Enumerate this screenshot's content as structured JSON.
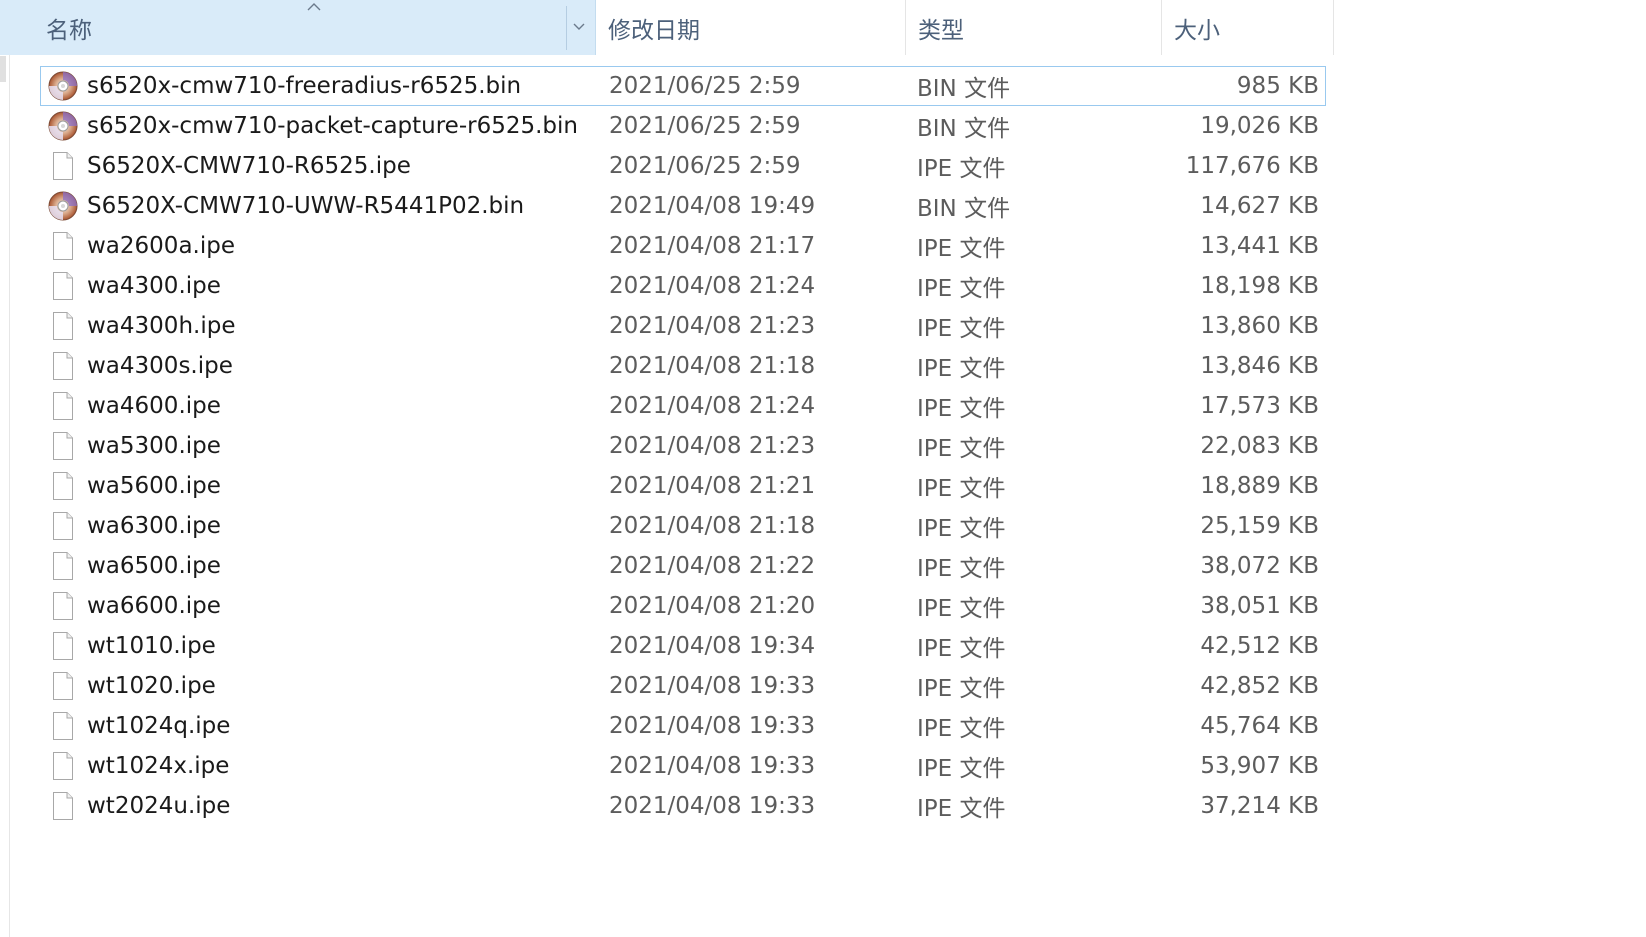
{
  "header": {
    "columns": {
      "name": "名称",
      "date": "修改日期",
      "type": "类型",
      "size": "大小"
    },
    "sort_icon": "sort-up-icon",
    "dropdown_icon": "chevron-down-icon"
  },
  "colors": {
    "header_highlight": "#d9ebf9",
    "selected_border": "#99c9ef",
    "header_text": "#4c607a"
  },
  "files": [
    {
      "name": "s6520x-cmw710-freeradius-r6525.bin",
      "date": "2021/06/25 2:59",
      "type": "BIN 文件",
      "size": "985 KB",
      "icon": "disc-image-icon",
      "selected": true
    },
    {
      "name": "s6520x-cmw710-packet-capture-r6525.bin",
      "date": "2021/06/25 2:59",
      "type": "BIN 文件",
      "size": "19,026 KB",
      "icon": "disc-image-icon",
      "selected": false
    },
    {
      "name": "S6520X-CMW710-R6525.ipe",
      "date": "2021/06/25 2:59",
      "type": "IPE 文件",
      "size": "117,676 KB",
      "icon": "blank-file-icon",
      "selected": false
    },
    {
      "name": "S6520X-CMW710-UWW-R5441P02.bin",
      "date": "2021/04/08 19:49",
      "type": "BIN 文件",
      "size": "14,627 KB",
      "icon": "disc-image-icon",
      "selected": false
    },
    {
      "name": "wa2600a.ipe",
      "date": "2021/04/08 21:17",
      "type": "IPE 文件",
      "size": "13,441 KB",
      "icon": "blank-file-icon",
      "selected": false
    },
    {
      "name": "wa4300.ipe",
      "date": "2021/04/08 21:24",
      "type": "IPE 文件",
      "size": "18,198 KB",
      "icon": "blank-file-icon",
      "selected": false
    },
    {
      "name": "wa4300h.ipe",
      "date": "2021/04/08 21:23",
      "type": "IPE 文件",
      "size": "13,860 KB",
      "icon": "blank-file-icon",
      "selected": false
    },
    {
      "name": "wa4300s.ipe",
      "date": "2021/04/08 21:18",
      "type": "IPE 文件",
      "size": "13,846 KB",
      "icon": "blank-file-icon",
      "selected": false
    },
    {
      "name": "wa4600.ipe",
      "date": "2021/04/08 21:24",
      "type": "IPE 文件",
      "size": "17,573 KB",
      "icon": "blank-file-icon",
      "selected": false
    },
    {
      "name": "wa5300.ipe",
      "date": "2021/04/08 21:23",
      "type": "IPE 文件",
      "size": "22,083 KB",
      "icon": "blank-file-icon",
      "selected": false
    },
    {
      "name": "wa5600.ipe",
      "date": "2021/04/08 21:21",
      "type": "IPE 文件",
      "size": "18,889 KB",
      "icon": "blank-file-icon",
      "selected": false
    },
    {
      "name": "wa6300.ipe",
      "date": "2021/04/08 21:18",
      "type": "IPE 文件",
      "size": "25,159 KB",
      "icon": "blank-file-icon",
      "selected": false
    },
    {
      "name": "wa6500.ipe",
      "date": "2021/04/08 21:22",
      "type": "IPE 文件",
      "size": "38,072 KB",
      "icon": "blank-file-icon",
      "selected": false
    },
    {
      "name": "wa6600.ipe",
      "date": "2021/04/08 21:20",
      "type": "IPE 文件",
      "size": "38,051 KB",
      "icon": "blank-file-icon",
      "selected": false
    },
    {
      "name": "wt1010.ipe",
      "date": "2021/04/08 19:34",
      "type": "IPE 文件",
      "size": "42,512 KB",
      "icon": "blank-file-icon",
      "selected": false
    },
    {
      "name": "wt1020.ipe",
      "date": "2021/04/08 19:33",
      "type": "IPE 文件",
      "size": "42,852 KB",
      "icon": "blank-file-icon",
      "selected": false
    },
    {
      "name": "wt1024q.ipe",
      "date": "2021/04/08 19:33",
      "type": "IPE 文件",
      "size": "45,764 KB",
      "icon": "blank-file-icon",
      "selected": false
    },
    {
      "name": "wt1024x.ipe",
      "date": "2021/04/08 19:33",
      "type": "IPE 文件",
      "size": "53,907 KB",
      "icon": "blank-file-icon",
      "selected": false
    },
    {
      "name": "wt2024u.ipe",
      "date": "2021/04/08 19:33",
      "type": "IPE 文件",
      "size": "37,214 KB",
      "icon": "blank-file-icon",
      "selected": false
    }
  ]
}
